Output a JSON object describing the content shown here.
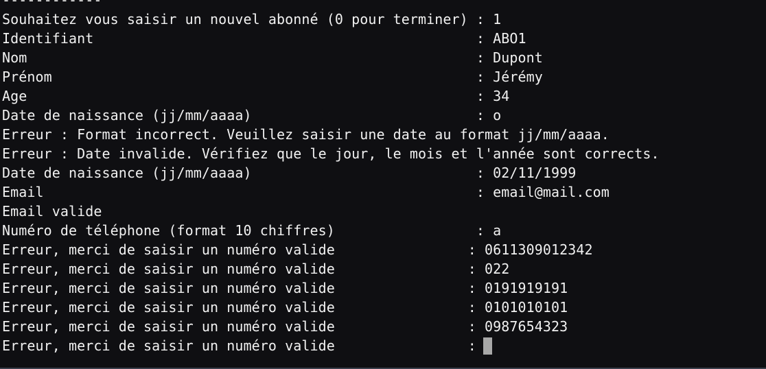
{
  "terminal": {
    "lines": [
      "------------",
      "Souhaitez vous saisir un nouvel abonné (0 pour terminer) : 1",
      "Identifiant                                              : ABO1",
      "Nom                                                      : Dupont",
      "Prénom                                                   : Jérémy",
      "Age                                                      : 34",
      "Date de naissance (jj/mm/aaaa)                           : o",
      "Erreur : Format incorrect. Veuillez saisir une date au format jj/mm/aaaa.",
      "Erreur : Date invalide. Vérifiez que le jour, le mois et l'année sont corrects.",
      "Date de naissance (jj/mm/aaaa)                           : 02/11/1999",
      "Email                                                    : email@mail.com",
      "Email valide",
      "Numéro de téléphone (format 10 chiffres)                 : a",
      "Erreur, merci de saisir un numéro valide                : 0611309012342",
      "Erreur, merci de saisir un numéro valide                : 022",
      "Erreur, merci de saisir un numéro valide                : 0191919191",
      "Erreur, merci de saisir un numéro valide                : 0101010101",
      "Erreur, merci de saisir un numéro valide                : 0987654323",
      "Erreur, merci de saisir un numéro valide                :"
    ]
  }
}
